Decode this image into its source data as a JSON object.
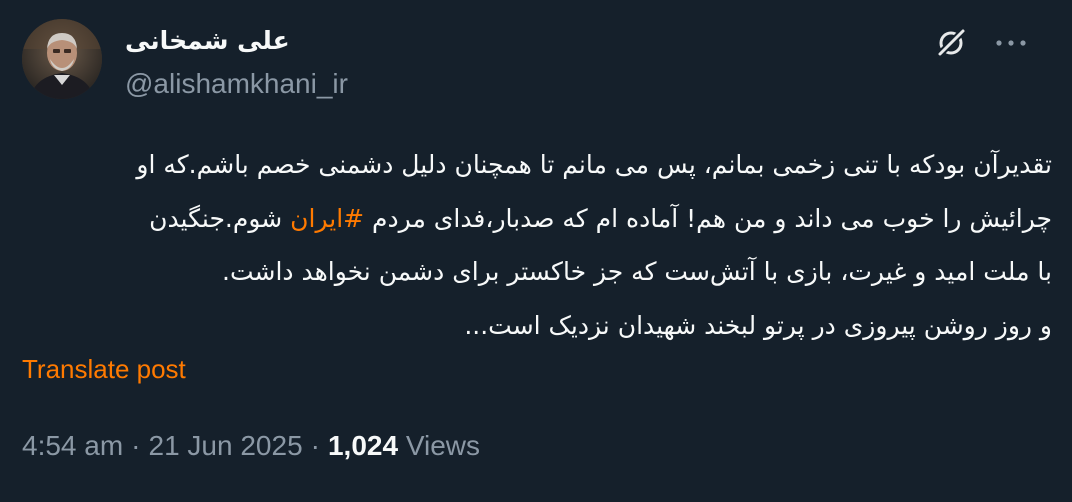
{
  "author": {
    "display_name": "علی شمخانی",
    "handle": "@alishamkhani_ir",
    "avatar_icon": "avatar-photo"
  },
  "actions": {
    "grok_icon": "grok-slash-circle-icon",
    "more_icon": "more-horizontal-icon"
  },
  "post": {
    "line1": "تقدیرآن بودکه با تنی زخمی بمانم، پس می مانم تا همچنان دلیل دشمنی خصم باشم.که او",
    "line2_before": "چرائیش را خوب می داند و من هم! آماده ام که صدبار،فدای مردم ",
    "hashtag": "#ایران",
    "line2_after": " شوم.جنگیدن",
    "line3": "با ملت امید و غیرت، بازی با آتش‌ست که جز خاکستر برای دشمن نخواهد داشت.",
    "line4": "و روز روشن پیروزی در پرتو لبخند شهیدان نزدیک است..."
  },
  "translate_label": "Translate post",
  "meta": {
    "time": "4:54 am",
    "separator": "·",
    "date": "21 Jun 2025",
    "views_count": "1,024",
    "views_label": "Views"
  },
  "colors": {
    "background": "#15202b",
    "text_primary": "#f7f9f9",
    "text_secondary": "#8b98a5",
    "accent": "#ff7a00"
  }
}
